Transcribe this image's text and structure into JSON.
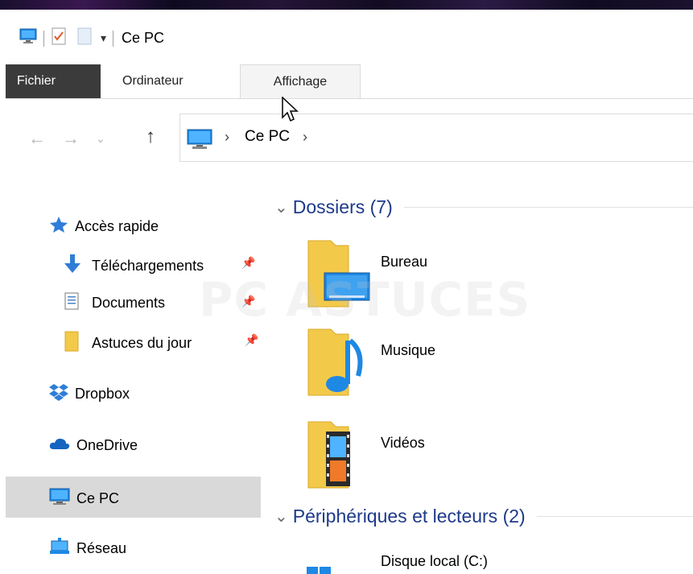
{
  "window": {
    "title": "Ce PC",
    "qat_dropdown_glyph": "▾"
  },
  "ribbon": {
    "tabs": [
      {
        "label": "Fichier",
        "active": true
      },
      {
        "label": "Ordinateur",
        "active": false
      },
      {
        "label": "Affichage",
        "active": false,
        "hovered": true
      }
    ]
  },
  "navigation": {
    "back_icon": "arrow-left-icon",
    "forward_icon": "arrow-right-icon",
    "recent_icon": "chevron-down-icon",
    "up_icon": "arrow-up-icon"
  },
  "address": {
    "location": "Ce PC",
    "separator": "›"
  },
  "sidebar": {
    "items": [
      {
        "label": "Accès rapide",
        "icon": "star-icon"
      },
      {
        "label": "Téléchargements",
        "icon": "download-icon",
        "pinned": true
      },
      {
        "label": "Documents",
        "icon": "document-icon",
        "pinned": true
      },
      {
        "label": "Astuces du jour",
        "icon": "folder-icon",
        "pinned": true
      },
      {
        "label": "Dropbox",
        "icon": "dropbox-icon"
      },
      {
        "label": "OneDrive",
        "icon": "cloud-icon"
      },
      {
        "label": "Ce PC",
        "icon": "computer-icon",
        "selected": true
      },
      {
        "label": "Réseau",
        "icon": "network-icon"
      }
    ]
  },
  "content": {
    "groups": [
      {
        "title": "Dossiers (7)"
      },
      {
        "title": "Périphériques et lecteurs (2)"
      }
    ],
    "folders": [
      {
        "label": "Bureau",
        "icon": "desktop-folder-icon"
      },
      {
        "label": "Musique",
        "icon": "music-folder-icon"
      },
      {
        "label": "Vidéos",
        "icon": "video-folder-icon"
      }
    ],
    "drives": [
      {
        "label": "Disque local (C:)",
        "icon": "windows-drive-icon"
      }
    ]
  },
  "watermark": "PC ASTUCES",
  "colors": {
    "fichier_tab_bg": "#3b3b3b",
    "group_title": "#1e3a8a",
    "selected_nav_bg": "#d9d9d9",
    "folder_yellow": "#f3c94a"
  }
}
